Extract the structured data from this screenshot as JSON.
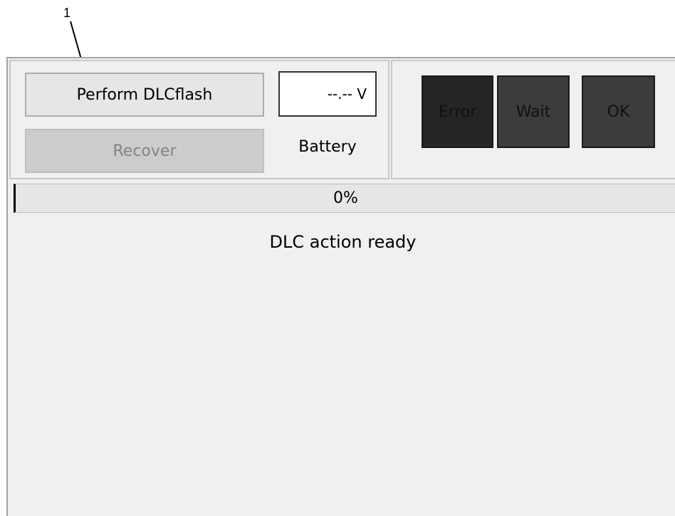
{
  "callout": {
    "number": "1"
  },
  "panel": {
    "perform_button_label": "Perform DLCflash",
    "recover_button_label": "Recover",
    "voltage_value": "--.-- V",
    "battery_label": "Battery"
  },
  "status_indicators": {
    "error_label": "Error",
    "wait_label": "Wait",
    "ok_label": "OK"
  },
  "progress": {
    "percent": 0,
    "label": "0%"
  },
  "message": {
    "text": "DLC action ready"
  },
  "colors": {
    "window_background": "#f0f0f0",
    "error_indicator": "#252525",
    "wait_indicator": "#3c3c3c",
    "ok_indicator": "#3c3c3c",
    "disabled_text": "#838383"
  }
}
